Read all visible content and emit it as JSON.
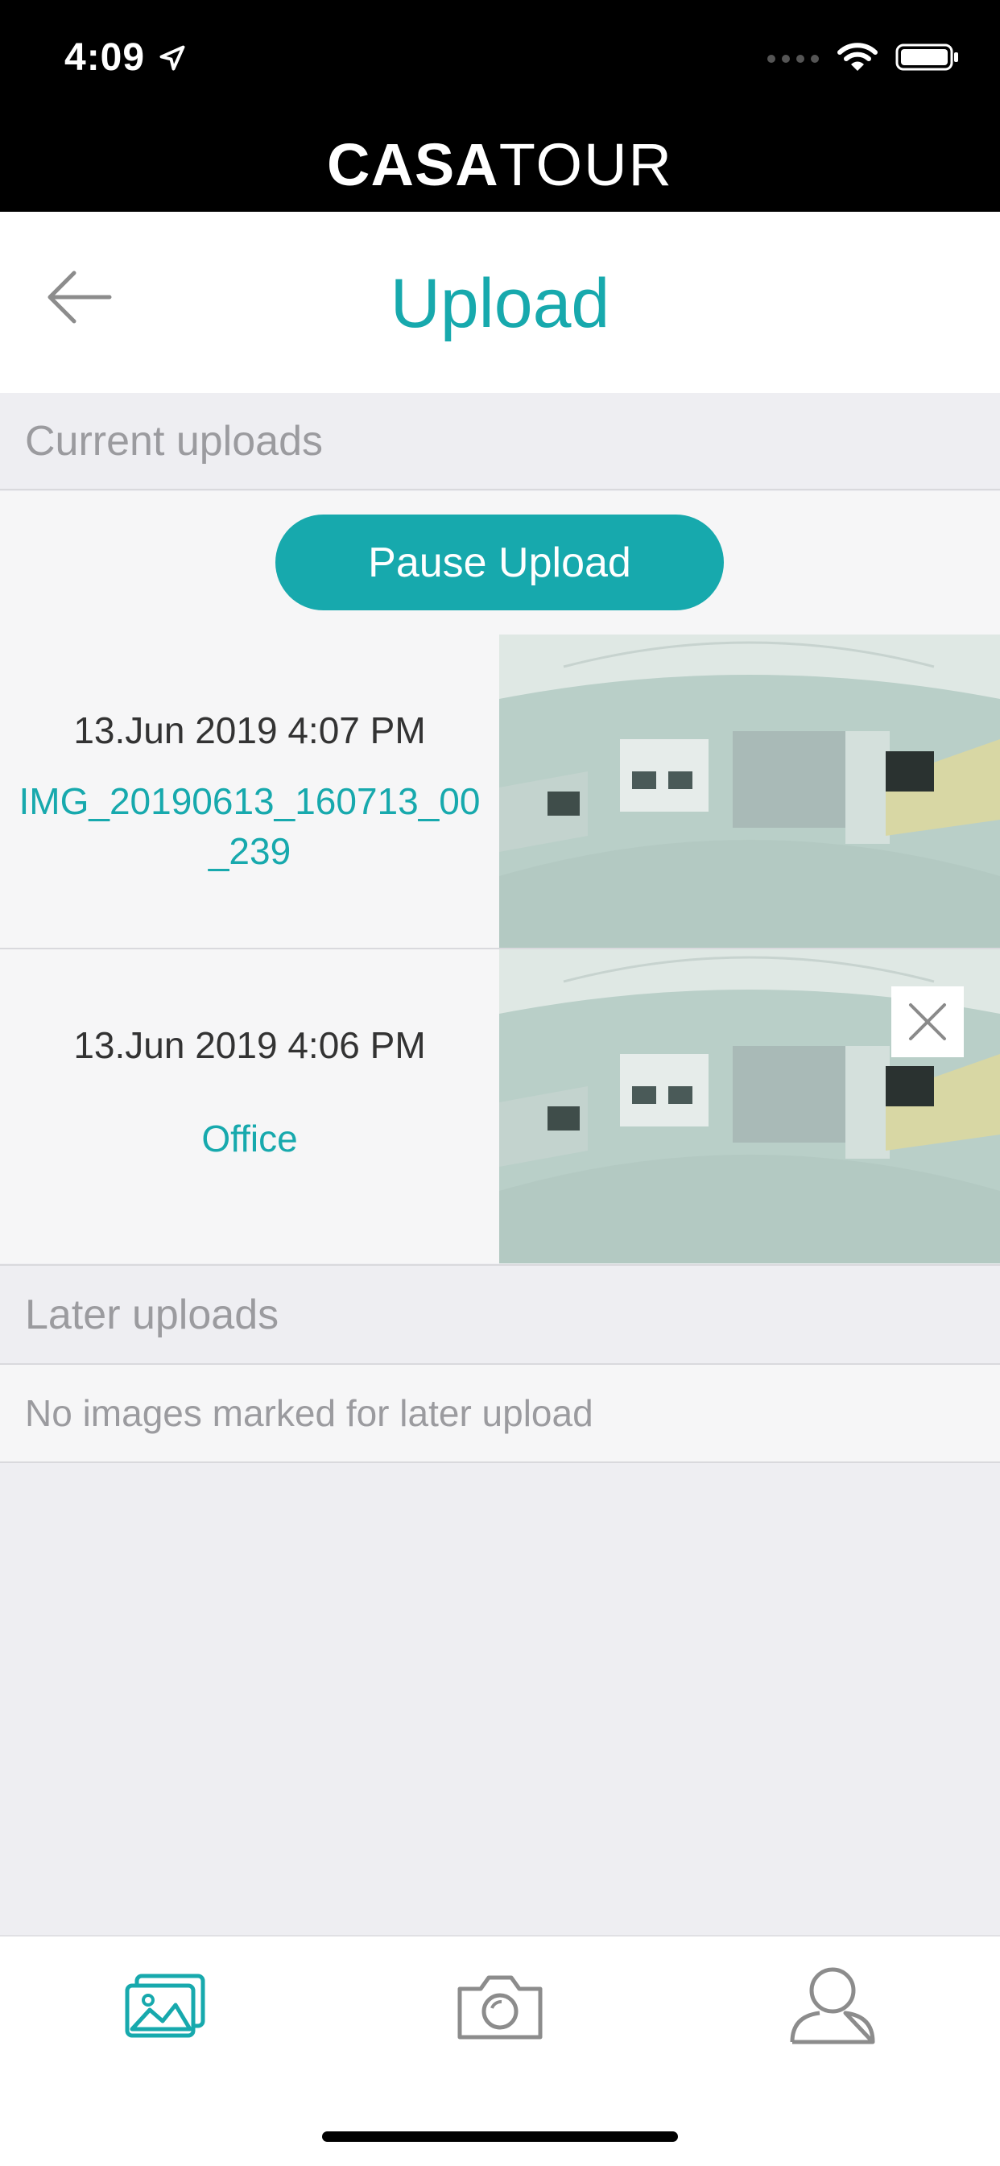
{
  "status_bar": {
    "time": "4:09"
  },
  "brand": {
    "part1": "CASA",
    "part2": "TOUR"
  },
  "header": {
    "title": "Upload"
  },
  "current_uploads": {
    "heading": "Current uploads",
    "pause_label": "Pause Upload",
    "items": [
      {
        "date": "13.Jun 2019 4:07 PM",
        "name": "IMG_20190613_160713_00_239"
      },
      {
        "date": "13.Jun 2019 4:06 PM",
        "name": "Office"
      }
    ]
  },
  "later_uploads": {
    "heading": "Later uploads",
    "empty_message": "No images marked for later upload"
  },
  "tabs": [
    "gallery-icon",
    "camera-icon",
    "profile-icon"
  ],
  "colors": {
    "accent": "#17a9ad",
    "background": "#eeeef2",
    "black": "#000000"
  }
}
